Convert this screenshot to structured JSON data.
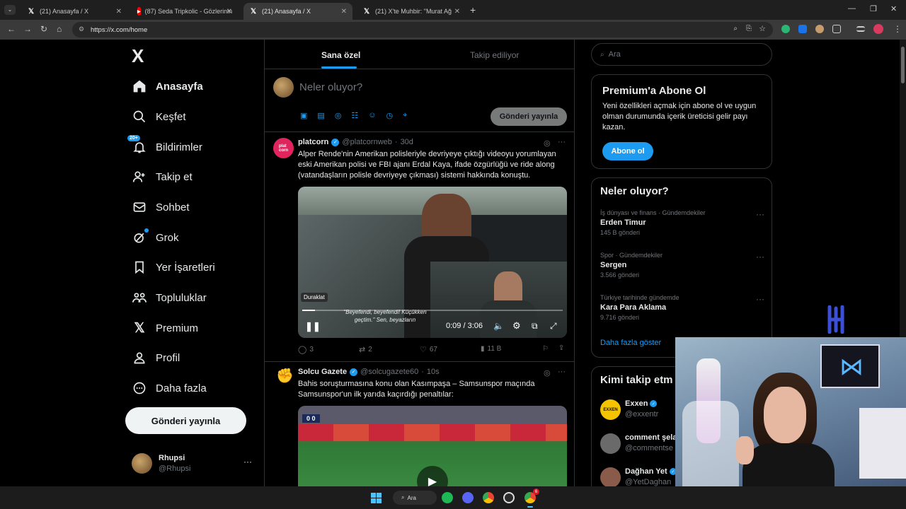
{
  "browser": {
    "tabs": [
      {
        "label": "(21) Anasayfa / X",
        "icon": "x-icon"
      },
      {
        "label": "(87) Seda Tripkolic - Gözlerinin",
        "icon": "youtube-icon"
      },
      {
        "label": "(21) Anasayfa / X",
        "icon": "x-icon"
      },
      {
        "label": "(21) X'te Muhbir: \"Murat Ağ",
        "icon": "x-icon"
      }
    ],
    "url": "https://x.com/home"
  },
  "nav": {
    "logo": "X",
    "items": [
      {
        "label": "Anasayfa",
        "icon": "home-icon"
      },
      {
        "label": "Keşfet",
        "icon": "search-icon"
      },
      {
        "label": "Bildirimler",
        "icon": "bell-icon",
        "badge": "20+"
      },
      {
        "label": "Takip et",
        "icon": "follow-icon"
      },
      {
        "label": "Sohbet",
        "icon": "mail-icon"
      },
      {
        "label": "Grok",
        "icon": "grok-icon"
      },
      {
        "label": "Yer İşaretleri",
        "icon": "bookmark-icon"
      },
      {
        "label": "Topluluklar",
        "icon": "communities-icon"
      },
      {
        "label": "Premium",
        "icon": "x-icon"
      },
      {
        "label": "Profil",
        "icon": "profile-icon"
      },
      {
        "label": "Daha fazla",
        "icon": "more-icon"
      }
    ],
    "post_button": "Gönderi yayınla",
    "account": {
      "name": "Rhupsi",
      "handle": "@Rhupsi"
    }
  },
  "feed": {
    "tabs": [
      "Sana özel",
      "Takip ediliyor"
    ],
    "compose": {
      "placeholder": "Neler oluyor?",
      "button": "Gönderi yayınla"
    },
    "tweets": [
      {
        "name": "platcorn",
        "handle": "@platcornweb",
        "time": "30d",
        "text": "Alper Rende'nin Amerikan polisleriyle devriyeye çıktığı videoyu yorumlayan eski Amerikan polisi ve FBI ajanı Erdal Kaya, ifade özgürlüğü ve ride along (vatandaşların polisle devriyeye çıkması) sistemi hakkında konuştu.",
        "video": {
          "tooltip": "Duraklat",
          "subtitle1": "\"Beyefendi, beyefendi! Küçükken",
          "subtitle2": "geçtim.\" Sen, beyazların",
          "time": "0:09 / 3:06",
          "progress": 0.05
        },
        "stats": {
          "replies": "3",
          "reposts": "2",
          "likes": "67",
          "views": "11 B"
        }
      },
      {
        "name": "Solcu Gazete",
        "handle": "@solcugazete60",
        "time": "10s",
        "text": "Bahis soruşturmasına konu olan Kasımpaşa – Samsunspor maçında Samsunspor'un ilk yarıda kaçırdığı penaltılar:",
        "score": "0 0"
      }
    ]
  },
  "sidebar": {
    "search_placeholder": "Ara",
    "premium": {
      "title": "Premium'a Abone Ol",
      "text": "Yeni özellikleri açmak için abone ol ve uygun olman durumunda içerik üreticisi gelir payı kazan.",
      "button": "Abone ol"
    },
    "trends": {
      "title": "Neler oluyor?",
      "items": [
        {
          "category": "İş dünyası ve finans · Gündemdekiler",
          "name": "Erden Timur",
          "count": "145 B gönderi"
        },
        {
          "category": "Spor · Gündemdekiler",
          "name": "Sergen",
          "count": "3.566 gönderi"
        },
        {
          "category": "Türkiye tarihinde gündemde",
          "name": "Kara Para Aklama",
          "count": "9.716 gönderi"
        }
      ],
      "more": "Daha fazla göster"
    },
    "who_to_follow": {
      "title": "Kimi takip etm",
      "items": [
        {
          "name": "Exxen",
          "handle": "@exxentr",
          "avatar": "EXXEN"
        },
        {
          "name": "comment şela",
          "handle": "@commentse"
        },
        {
          "name": "Dağhan Yet",
          "handle": "@YetDaghan"
        }
      ]
    }
  },
  "taskbar": {
    "search": "Ara",
    "chrome_badge": "6"
  },
  "colors": {
    "accent": "#1d9bf0",
    "verified": "#1d9bf0"
  }
}
